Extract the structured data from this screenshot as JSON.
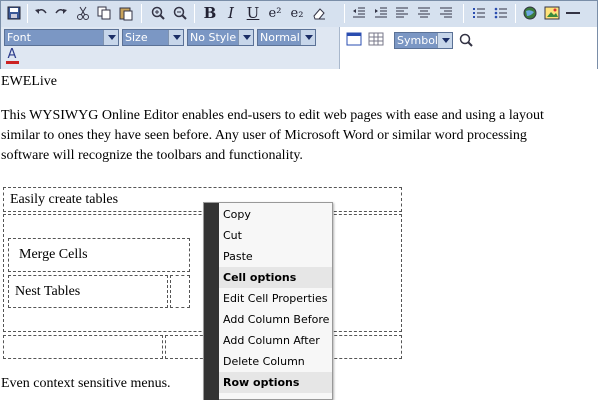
{
  "toolbar": {
    "row1_icons": [
      "save-icon",
      "undo-icon",
      "redo-icon",
      "cut-icon",
      "copy-icon",
      "paste-icon",
      "zoom-in-icon",
      "zoom-out-icon",
      "bold-icon",
      "italic-icon",
      "underline-icon",
      "superscript-icon",
      "subscript-icon",
      "eraser-icon",
      "outdent-icon",
      "indent-icon",
      "align-left-icon",
      "align-center-icon",
      "align-right-icon",
      "numbered-list-icon",
      "bullet-list-icon",
      "web-icon",
      "image-icon",
      "horizontal-rule-icon"
    ],
    "labels": {
      "bold": "B",
      "italic": "I",
      "underline": "U",
      "superscript": "e²",
      "subscript": "e₂"
    },
    "font_select": "Font",
    "size_select": "Size",
    "style_select": "No Style",
    "format_select": "Normal",
    "symbol_select": "Symbol",
    "font_color_letter": "A"
  },
  "editor": {
    "title_line": "EWELive",
    "paragraph_lines": [
      "This WYSIWYG Online Editor enables end-users to edit web pages with ease and using a layout",
      "similar to ones they have seen before. Any user of Microsoft Word or similar word processing",
      "software will recognize the toolbars and functionality."
    ],
    "table_caption": "Easily create tables",
    "merge_cells": "Merge Cells",
    "nest_tables": "Nest Tables",
    "footer_line": "Even context sensitive menus."
  },
  "context_menu": {
    "items": [
      {
        "label": "Copy",
        "header": false
      },
      {
        "label": "Cut",
        "header": false
      },
      {
        "label": "Paste",
        "header": false
      },
      {
        "label": "Cell options",
        "header": true
      },
      {
        "label": "Edit Cell Properties",
        "header": false
      },
      {
        "label": "Add Column Before",
        "header": false
      },
      {
        "label": "Add Column After",
        "header": false
      },
      {
        "label": "Delete Column",
        "header": false
      },
      {
        "label": "Row options",
        "header": true
      }
    ]
  },
  "colors": {
    "toolbar_bg": "#d6e1ef",
    "menu_gutter": "#333333",
    "font_color_bar": "#cc2222"
  }
}
